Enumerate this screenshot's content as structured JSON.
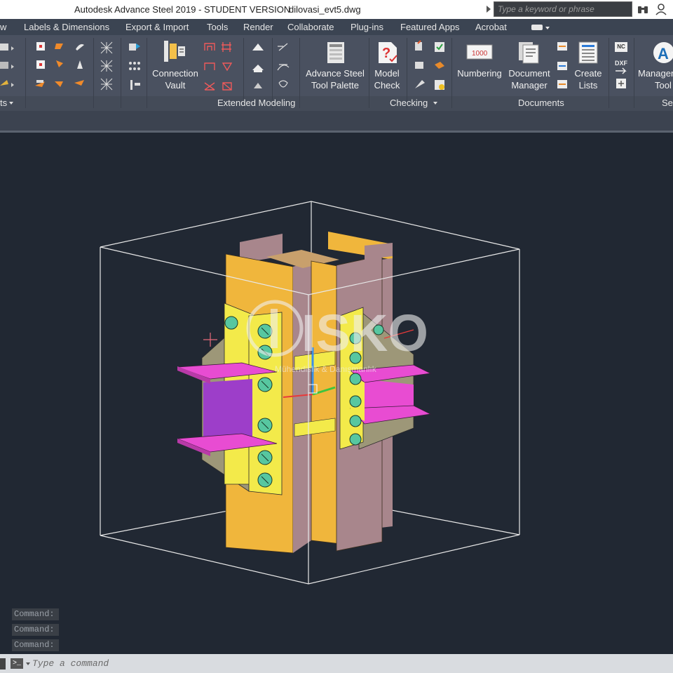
{
  "window": {
    "title": "Autodesk Advance Steel 2019 - STUDENT VERSION",
    "file": "dilovasi_evt5.dwg"
  },
  "search": {
    "placeholder": "Type a keyword or phrase"
  },
  "menu": {
    "items": [
      {
        "label": "w"
      },
      {
        "label": "Labels & Dimensions"
      },
      {
        "label": "Export & Import"
      },
      {
        "label": "Tools"
      },
      {
        "label": "Render"
      },
      {
        "label": "Collaborate"
      },
      {
        "label": "Plug-ins"
      },
      {
        "label": "Featured Apps"
      },
      {
        "label": "Acrobat"
      }
    ]
  },
  "ribbon": {
    "buttons": {
      "connection_vault": [
        "Connection",
        "Vault"
      ],
      "tool_palette": [
        "Advance Steel",
        "Tool Palette"
      ],
      "model_check": [
        "Model",
        "Check"
      ],
      "numbering": [
        "Numbering"
      ],
      "document_manager": [
        "Document",
        "Manager"
      ],
      "create_lists": [
        "Create",
        "Lists"
      ],
      "management_tools": [
        "Managen",
        "Tool"
      ]
    },
    "panels": {
      "left_partial": "ts",
      "extended_modeling": "Extended Modeling",
      "checking": "Checking",
      "documents": "Documents",
      "settings_partial": "Se"
    },
    "numbering_icon_text": "1000",
    "nc_text": "NC",
    "dxf_text": "DXF"
  },
  "viewport": {
    "watermark": {
      "logo": "ISKO",
      "tagline": "Mühendislik & Danışmanlık"
    }
  },
  "command": {
    "history": [
      "Command:",
      "Command:",
      "Command:"
    ],
    "placeholder": "Type a command"
  },
  "colors": {
    "background": "#212833",
    "ribbon": "#4a5160",
    "column": "#f0b63c",
    "web": "#a8868c",
    "plate_yellow": "#f3ea4a",
    "beam_magenta": "#e84cd2",
    "gusset_gray": "#9d9778",
    "bolt": "#57c7a0"
  }
}
